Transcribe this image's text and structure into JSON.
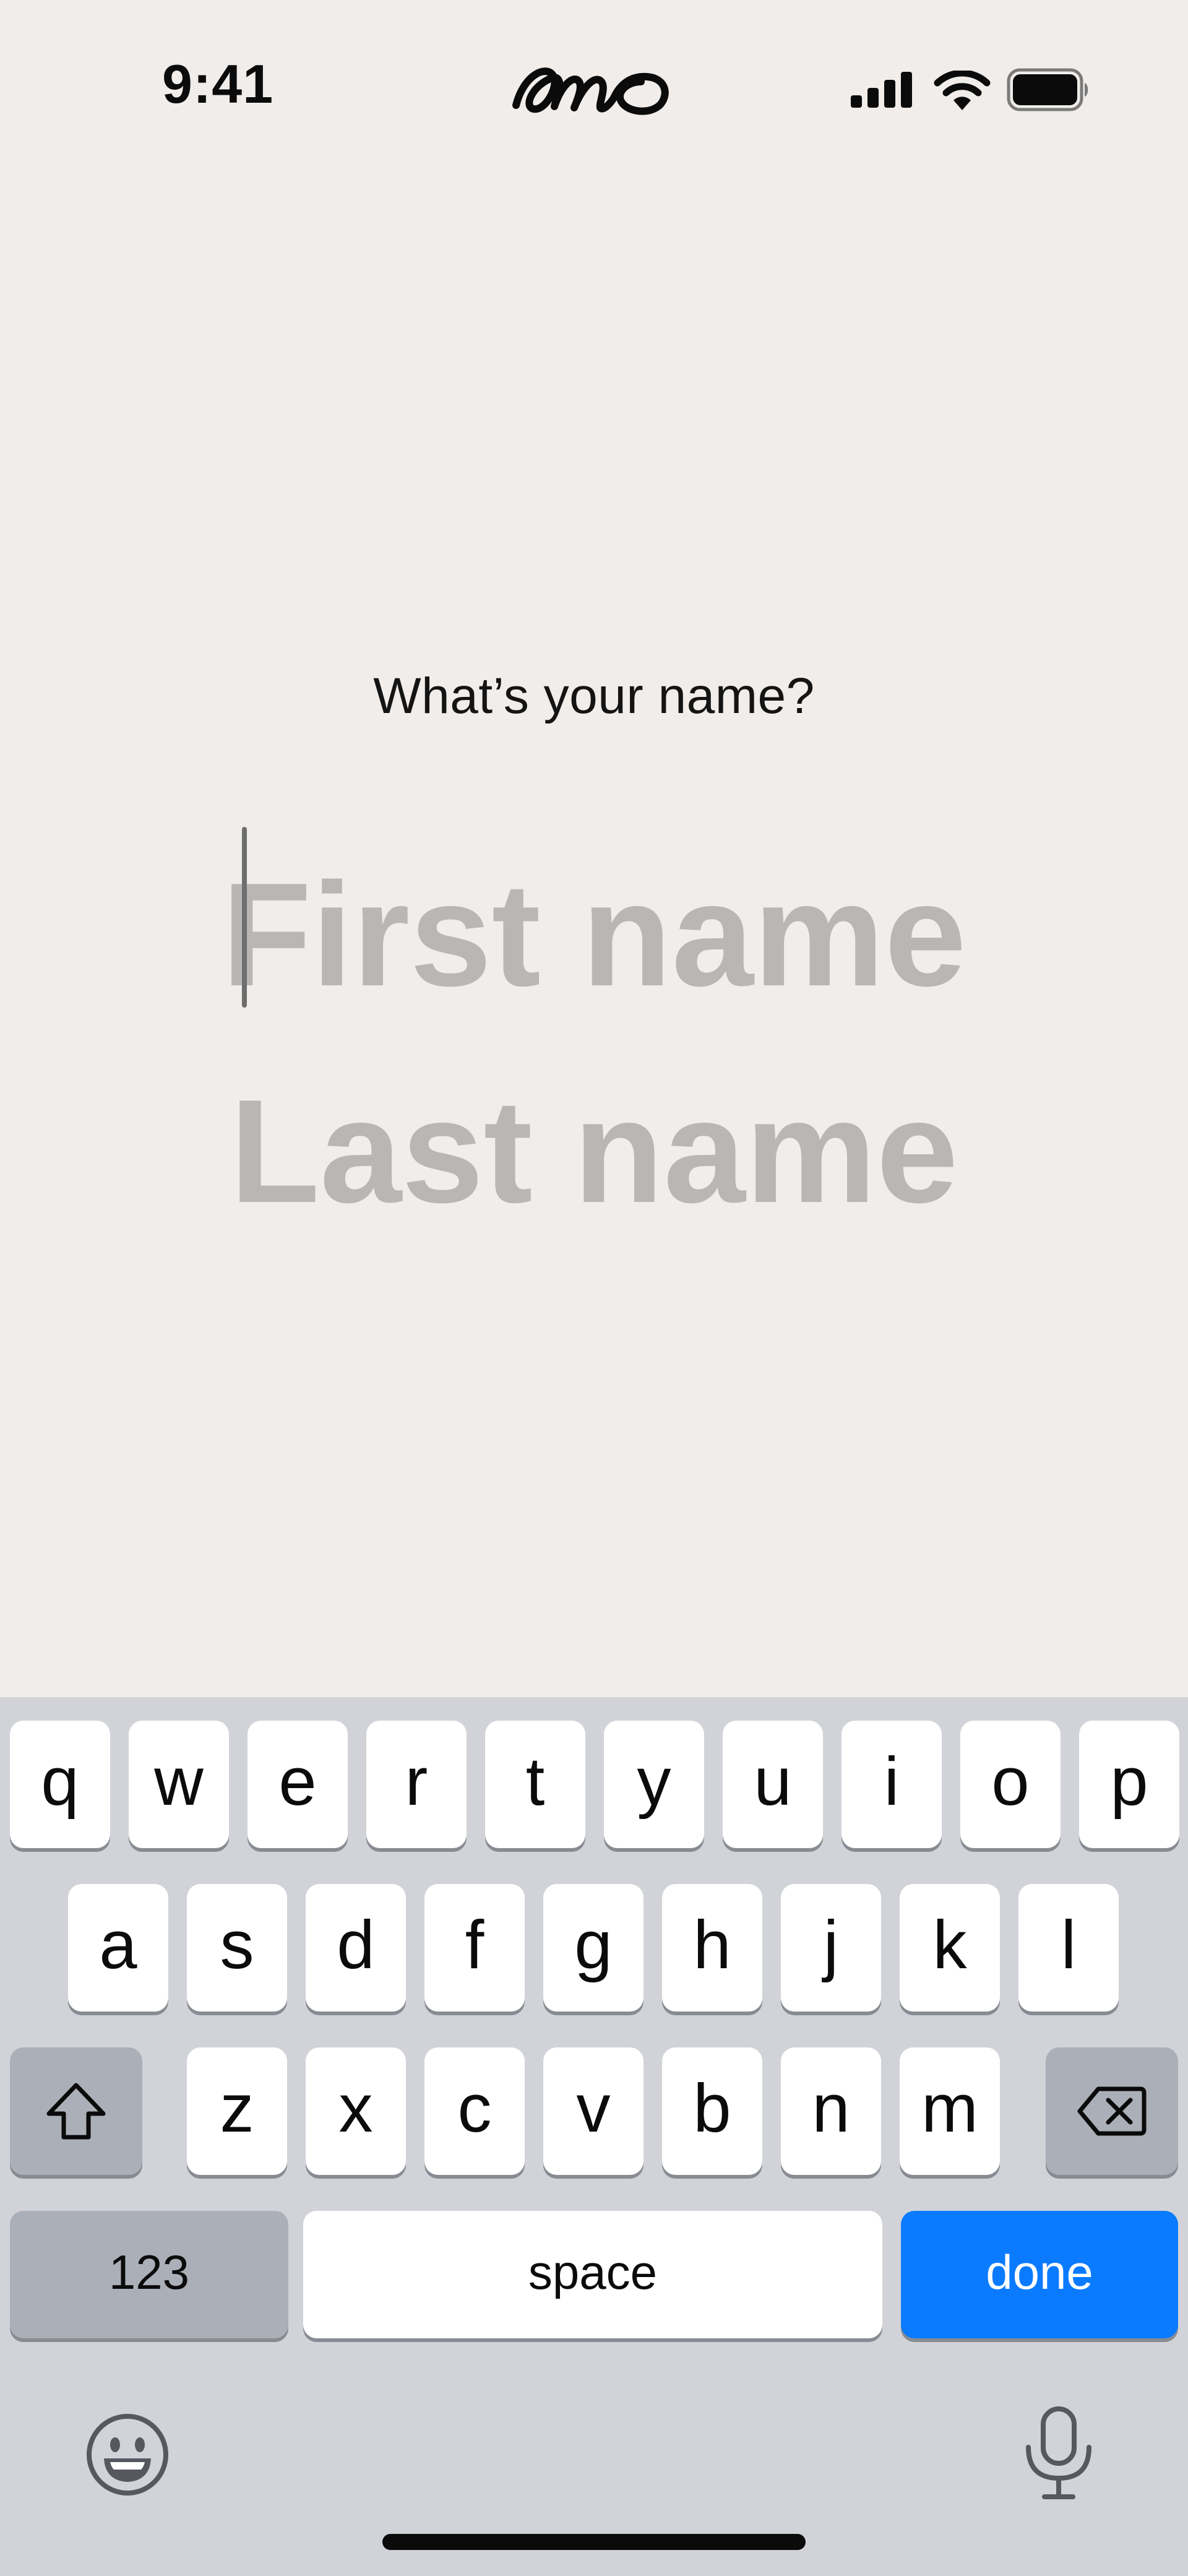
{
  "status_bar": {
    "time": "9:41",
    "logo_icon": "amo-logo-icon",
    "signal_icon": "cellular-signal-icon",
    "wifi_icon": "wifi-icon",
    "battery_icon": "battery-icon"
  },
  "form": {
    "prompt": "What’s your name?",
    "first_name": {
      "value": "",
      "placeholder": "First name"
    },
    "last_name": {
      "value": "",
      "placeholder": "Last name"
    }
  },
  "keyboard": {
    "row1": [
      "q",
      "w",
      "e",
      "r",
      "t",
      "y",
      "u",
      "i",
      "o",
      "p"
    ],
    "row2": [
      "a",
      "s",
      "d",
      "f",
      "g",
      "h",
      "j",
      "k",
      "l"
    ],
    "row3": [
      "z",
      "x",
      "c",
      "v",
      "b",
      "n",
      "m"
    ],
    "shift_icon": "shift-icon",
    "delete_icon": "delete-icon",
    "numbers_label": "123",
    "space_label": "space",
    "done_label": "done",
    "emoji_icon": "emoji-icon",
    "mic_icon": "microphone-icon"
  },
  "colors": {
    "background": "#f0edea",
    "placeholder": "#b9b7b5",
    "keyboard_bg": "#d1d3d9",
    "key": "#ffffff",
    "special_key": "#abafb8",
    "done_key": "#0a7bff"
  }
}
